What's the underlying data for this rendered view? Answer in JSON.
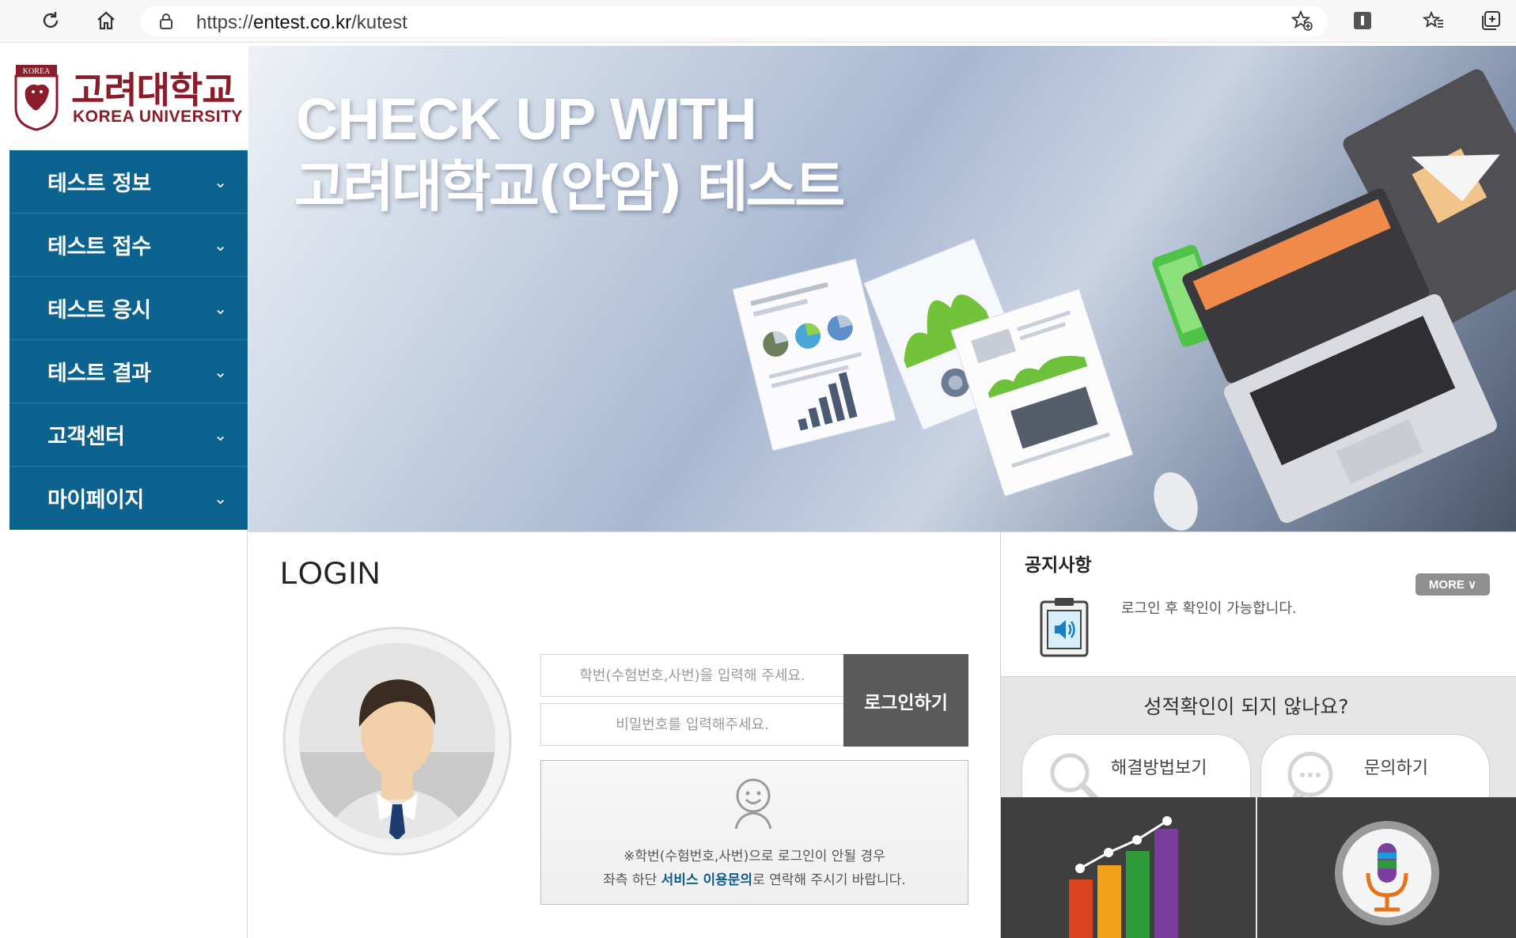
{
  "browser": {
    "url_prefix": "https://",
    "url_host": "entest.co.kr",
    "url_path": "/kutest"
  },
  "logo": {
    "name_kr": "고려대학교",
    "name_en": "KOREA UNIVERSITY",
    "seal_text": "KOREA"
  },
  "menu": [
    {
      "label": "테스트 정보"
    },
    {
      "label": "테스트 접수"
    },
    {
      "label": "테스트 응시"
    },
    {
      "label": "테스트 결과"
    },
    {
      "label": "고객센터"
    },
    {
      "label": "마이페이지"
    }
  ],
  "banner": {
    "line1": "CHECK UP WITH",
    "line2": "고려대학교(안암) 테스트"
  },
  "login": {
    "title": "LOGIN",
    "id_placeholder": "학번(수험번호,사번)을 입력해 주세요.",
    "pw_placeholder": "비밀번호를 입력해주세요.",
    "button": "로그인하기",
    "note_line1": "※학번(수험번호,사번)으로 로그인이 안될 경우",
    "note_line2_pre": "좌측 하단 ",
    "note_link": "서비스 이용문의",
    "note_line2_post": "로 연락해 주시기 바랍니다."
  },
  "notice": {
    "title": "공지사항",
    "more": "MORE ∨",
    "message": "로그인 후 확인이 가능합니다."
  },
  "help": {
    "question": "성적확인이 되지 않나요?",
    "solution_button": "해결방법보기",
    "inquiry_button": "문의하기"
  },
  "colors": {
    "menu_bg": "#0d638f",
    "brand_red": "#8b1d2a",
    "login_button": "#5a5a5a"
  }
}
